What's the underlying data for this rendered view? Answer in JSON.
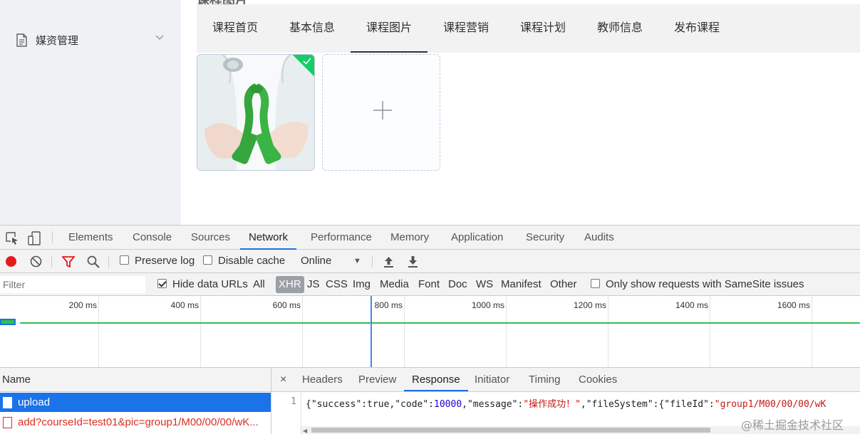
{
  "app": {
    "breadcrumb_title": "课程图片",
    "sidebar": {
      "items": [
        {
          "label": "媒资管理",
          "icon": "document-icon",
          "expand_icon": "chevron-down-icon"
        }
      ]
    },
    "tabs": [
      {
        "label": "课程首页"
      },
      {
        "label": "基本信息"
      },
      {
        "label": "课程图片",
        "active": true
      },
      {
        "label": "课程营销"
      },
      {
        "label": "课程计划"
      },
      {
        "label": "教师信息"
      },
      {
        "label": "发布课程"
      }
    ],
    "upload": {
      "uploaded_status": "success",
      "add_icon": "plus-icon"
    },
    "colors": {
      "sidebar_bg": "#f0f1f5",
      "tab_bar_bg": "#f2f2f2",
      "success_green": "#13ce66"
    }
  },
  "devtools": {
    "panel_tabs": [
      "Elements",
      "Console",
      "Sources",
      "Network",
      "Performance",
      "Memory",
      "Application",
      "Security",
      "Audits"
    ],
    "active_panel": "Network",
    "toolbar": {
      "preserve_log": "Preserve log",
      "disable_cache": "Disable cache",
      "throttle": "Online"
    },
    "filter": {
      "placeholder": "Filter",
      "hide_data_urls": "Hide data URLs",
      "types": [
        "All",
        "XHR",
        "JS",
        "CSS",
        "Img",
        "Media",
        "Font",
        "Doc",
        "WS",
        "Manifest",
        "Other"
      ],
      "active_type": "XHR",
      "samesite": "Only show requests with SameSite issues"
    },
    "timeline": {
      "ticks": [
        "200 ms",
        "400 ms",
        "600 ms",
        "800 ms",
        "1000 ms",
        "1200 ms",
        "1400 ms",
        "1600 ms"
      ]
    },
    "requests": {
      "header": "Name",
      "rows": [
        {
          "name": "upload",
          "state": "selected"
        },
        {
          "name": "add?courseId=test01&pic=group1/M00/00/00/wK...",
          "state": "error"
        }
      ]
    },
    "detail": {
      "close": "×",
      "tabs": [
        "Headers",
        "Preview",
        "Response",
        "Initiator",
        "Timing",
        "Cookies"
      ],
      "active_tab": "Response",
      "line_number": "1",
      "response": {
        "p1": "{\"success\":true,\"code\":",
        "n1": "10000",
        "p2": ",\"message\":",
        "s1": "\"操作成功！\"",
        "p3": ",\"fileSystem\":{\"fileId\":",
        "s2": "\"group1/M00/00/00/wK"
      }
    }
  },
  "watermark": "@稀土掘金技术社区"
}
